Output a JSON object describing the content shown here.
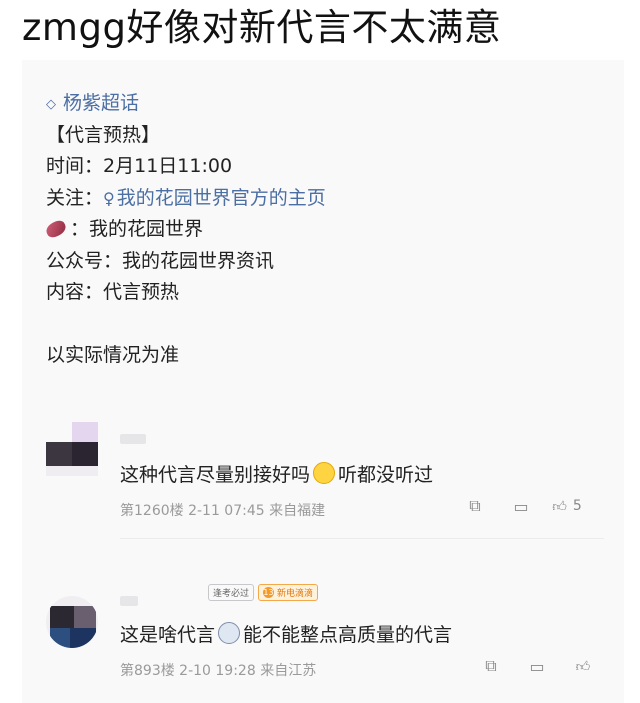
{
  "headline": "zmgg好像对新代言不太满意",
  "post": {
    "topic": "杨紫超话",
    "lines": {
      "l1": "【代言预热】",
      "time_label": "时间：",
      "time_value": "2月11日11:00",
      "follow_label": "关注：",
      "follow_link": "我的花园世界官方的主页",
      "potato_label": "：我的花园世界",
      "wechat": "公众号：我的花园世界资讯",
      "content": "内容：代言预热"
    },
    "note": "以实际情况为准"
  },
  "comments": [
    {
      "text_a": "这种代言尽量别接好吗",
      "text_b": "听都没听过",
      "info": "第1260楼 2-11 07:45 来自福建",
      "likes": "5"
    },
    {
      "tag1": "逢考必过",
      "tag2_level": "13",
      "tag2": "新电滴滴",
      "text_a": "这是啥代言",
      "text_b": "能不能整点高质量的代言",
      "info": "第893楼 2-10 19:28 来自江苏",
      "likes": ""
    }
  ]
}
